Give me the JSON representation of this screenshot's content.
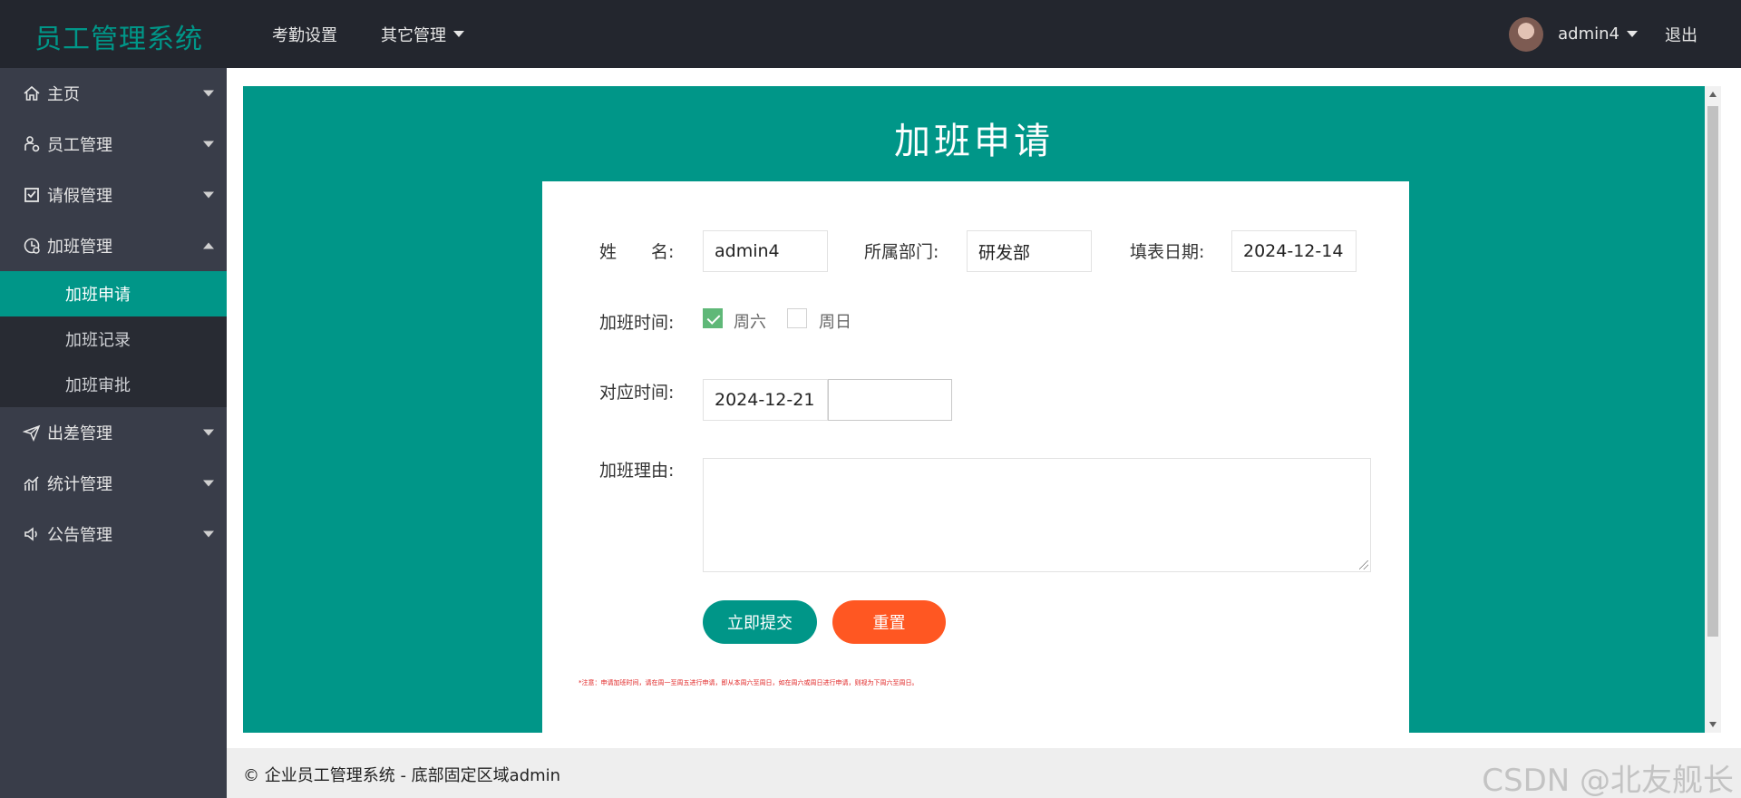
{
  "header": {
    "logo": "员工管理系统",
    "nav": [
      "考勤设置",
      "其它管理"
    ],
    "username": "admin4",
    "logout": "退出"
  },
  "sidebar": {
    "items": [
      {
        "label": "主页",
        "icon": "home-icon"
      },
      {
        "label": "员工管理",
        "icon": "employee-icon"
      },
      {
        "label": "请假管理",
        "icon": "leave-icon"
      },
      {
        "label": "加班管理",
        "icon": "overtime-icon",
        "expanded": true,
        "children": [
          "加班申请",
          "加班记录",
          "加班审批"
        ],
        "active_child": "加班申请"
      },
      {
        "label": "出差管理",
        "icon": "plane-icon"
      },
      {
        "label": "统计管理",
        "icon": "chart-icon"
      },
      {
        "label": "公告管理",
        "icon": "megaphone-icon"
      }
    ]
  },
  "form": {
    "title": "加班申请",
    "name_label": "姓　　名:",
    "name_value": "admin4",
    "dept_label": "所属部门:",
    "dept_value": "研发部",
    "date_label": "填表日期:",
    "date_value": "2024-12-14",
    "ot_time_label": "加班时间:",
    "saturday_label": "周六",
    "saturday_checked": true,
    "sunday_label": "周日",
    "sunday_checked": false,
    "corr_label": "对应时间:",
    "corr_value": "2024-12-21",
    "corr_value2": "",
    "reason_label": "加班理由:",
    "reason_value": "",
    "submit": "立即提交",
    "reset": "重置",
    "note": "*注意：申请加班时间，请在周一至周五进行申请，即从本周六至周日，如在周六或周日进行申请，则视为下周六至周日。"
  },
  "colors": {
    "primary": "#009688",
    "danger": "#ff5722",
    "header_bg": "#23262e",
    "sidebar_bg": "#393d49",
    "checkbox": "#5fb878"
  },
  "footer": {
    "text": "© 企业员工管理系统 - 底部固定区域admin",
    "watermark": "CSDN @北友舰长"
  }
}
